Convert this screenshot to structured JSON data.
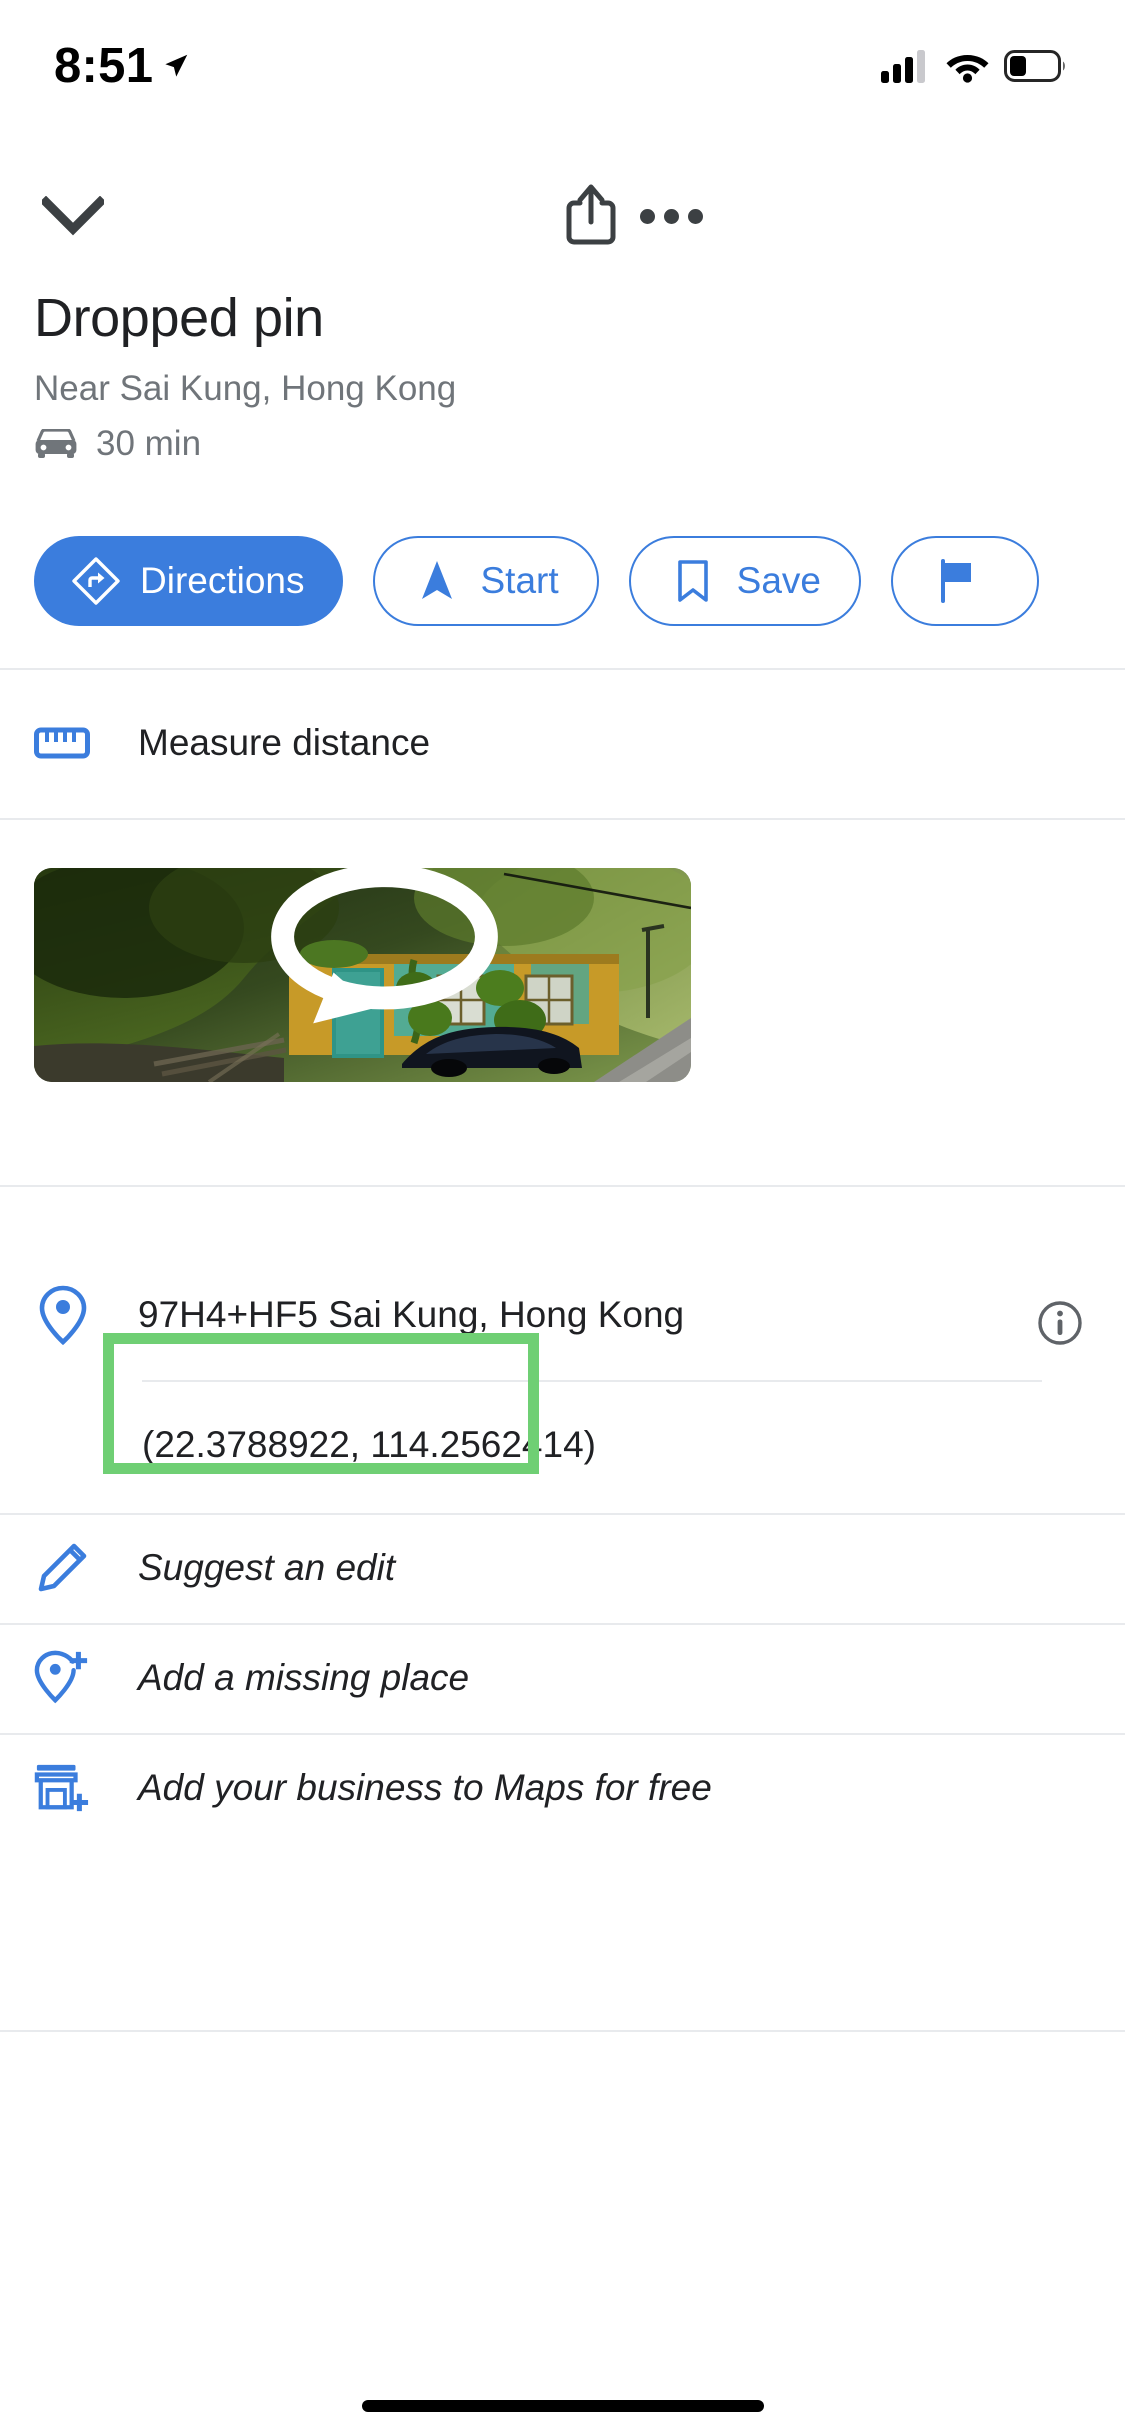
{
  "status_bar": {
    "time": "8:51",
    "location_icon": "location-arrow-icon",
    "cellular_icon": "cellular-bars-icon",
    "wifi_icon": "wifi-icon",
    "battery_icon": "battery-low-icon"
  },
  "header": {
    "collapse_icon": "chevron-down-icon",
    "share_icon": "share-icon",
    "more_icon": "more-horizontal-icon"
  },
  "place": {
    "title": "Dropped pin",
    "subtitle": "Near Sai Kung, Hong Kong",
    "drive_icon": "car-icon",
    "drive_time": "30 min"
  },
  "actions": [
    {
      "label": "Directions",
      "icon": "directions-icon",
      "style": "primary"
    },
    {
      "label": "Start",
      "icon": "navigation-arrow-icon",
      "style": "outline"
    },
    {
      "label": "Save",
      "icon": "bookmark-icon",
      "style": "outline"
    },
    {
      "label": "",
      "icon": "flag-icon",
      "style": "outline"
    }
  ],
  "measure": {
    "label": "Measure distance",
    "icon": "ruler-icon"
  },
  "photo": {
    "alt": "Overgrown abandoned yellow and teal hut beside a road with a dark car",
    "streetview_icon": "street-view-360-icon"
  },
  "address": {
    "icon": "map-pin-icon",
    "text": "97H4+HF5 Sai Kung, Hong Kong",
    "info_icon": "info-circle-icon"
  },
  "coordinates": {
    "text": "(22.3788922, 114.2562414)",
    "highlight_color": "#6fcf74"
  },
  "contribute": [
    {
      "label": "Suggest an edit",
      "icon": "pencil-icon"
    },
    {
      "label": "Add a missing place",
      "icon": "add-place-icon"
    },
    {
      "label": "Add your business to Maps for free",
      "icon": "add-business-icon"
    }
  ],
  "colors": {
    "accent_blue": "#3b7ddd",
    "text_primary": "#202124",
    "text_secondary": "#70757a",
    "divider": "#e8eaed",
    "highlight_green": "#6fcf74"
  },
  "home_indicator": "home-indicator"
}
